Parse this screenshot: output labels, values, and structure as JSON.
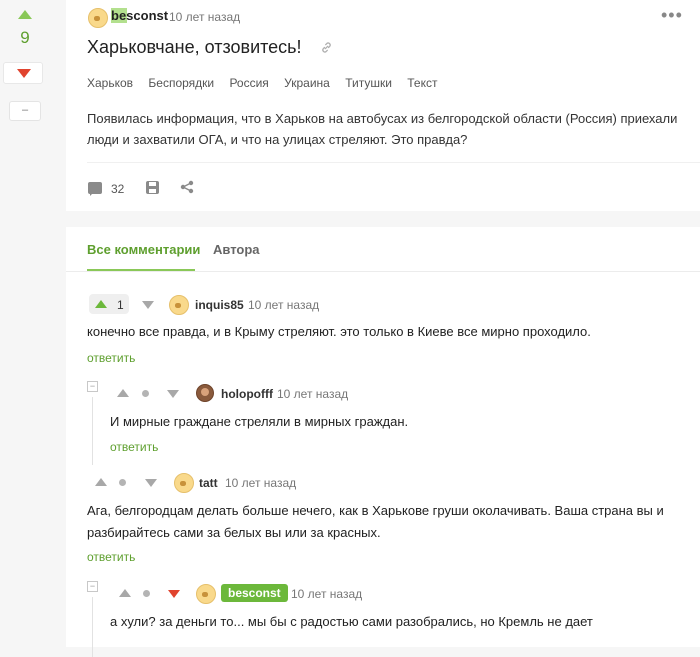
{
  "post": {
    "score": "9",
    "minus_label": "–",
    "author": "besconst",
    "time": "10 лет назад",
    "title": "Харьковчане, отзовитесь!",
    "tags": [
      "Харьков",
      "Беспорядки",
      "Россия",
      "Украина",
      "Титушки",
      "Текст"
    ],
    "text": "Появилась информация, что в Харьков на автобусах из белгородской области (Россия) приехали люди и захватили ОГА, и что на улицах стреляют. Это правда?",
    "comments_count": "32"
  },
  "tabs": [
    {
      "label": "Все комментарии",
      "active": true
    },
    {
      "label": "Автора",
      "active": false
    }
  ],
  "comments": [
    {
      "score": "1",
      "author": "inquis85",
      "time": "10 лет назад",
      "text": "конечно все правда, и в Крыму стреляют. это только в Киеве все мирно проходило.",
      "reply": "ответить"
    },
    {
      "author": "holopofff",
      "time": "10 лет назад",
      "text": "И мирные граждане стреляли в мирных граждан.",
      "reply": "ответить"
    },
    {
      "author": "tatt",
      "time": "10 лет назад",
      "text": "Ага, белгородцам делать больше нечего, как в Харькове груши околачивать. Ваша страна вы и разбирайтесь сами за белых вы или за красных.",
      "reply": "ответить"
    },
    {
      "author": "besconst",
      "time": "10 лет назад",
      "text": "а хули? за деньги то... мы бы с радостью сами разобрались, но Кремль не дает"
    }
  ],
  "colors": {
    "accent": "#8ac858",
    "downvote": "#e0432e",
    "link": "#5e9f2e"
  }
}
